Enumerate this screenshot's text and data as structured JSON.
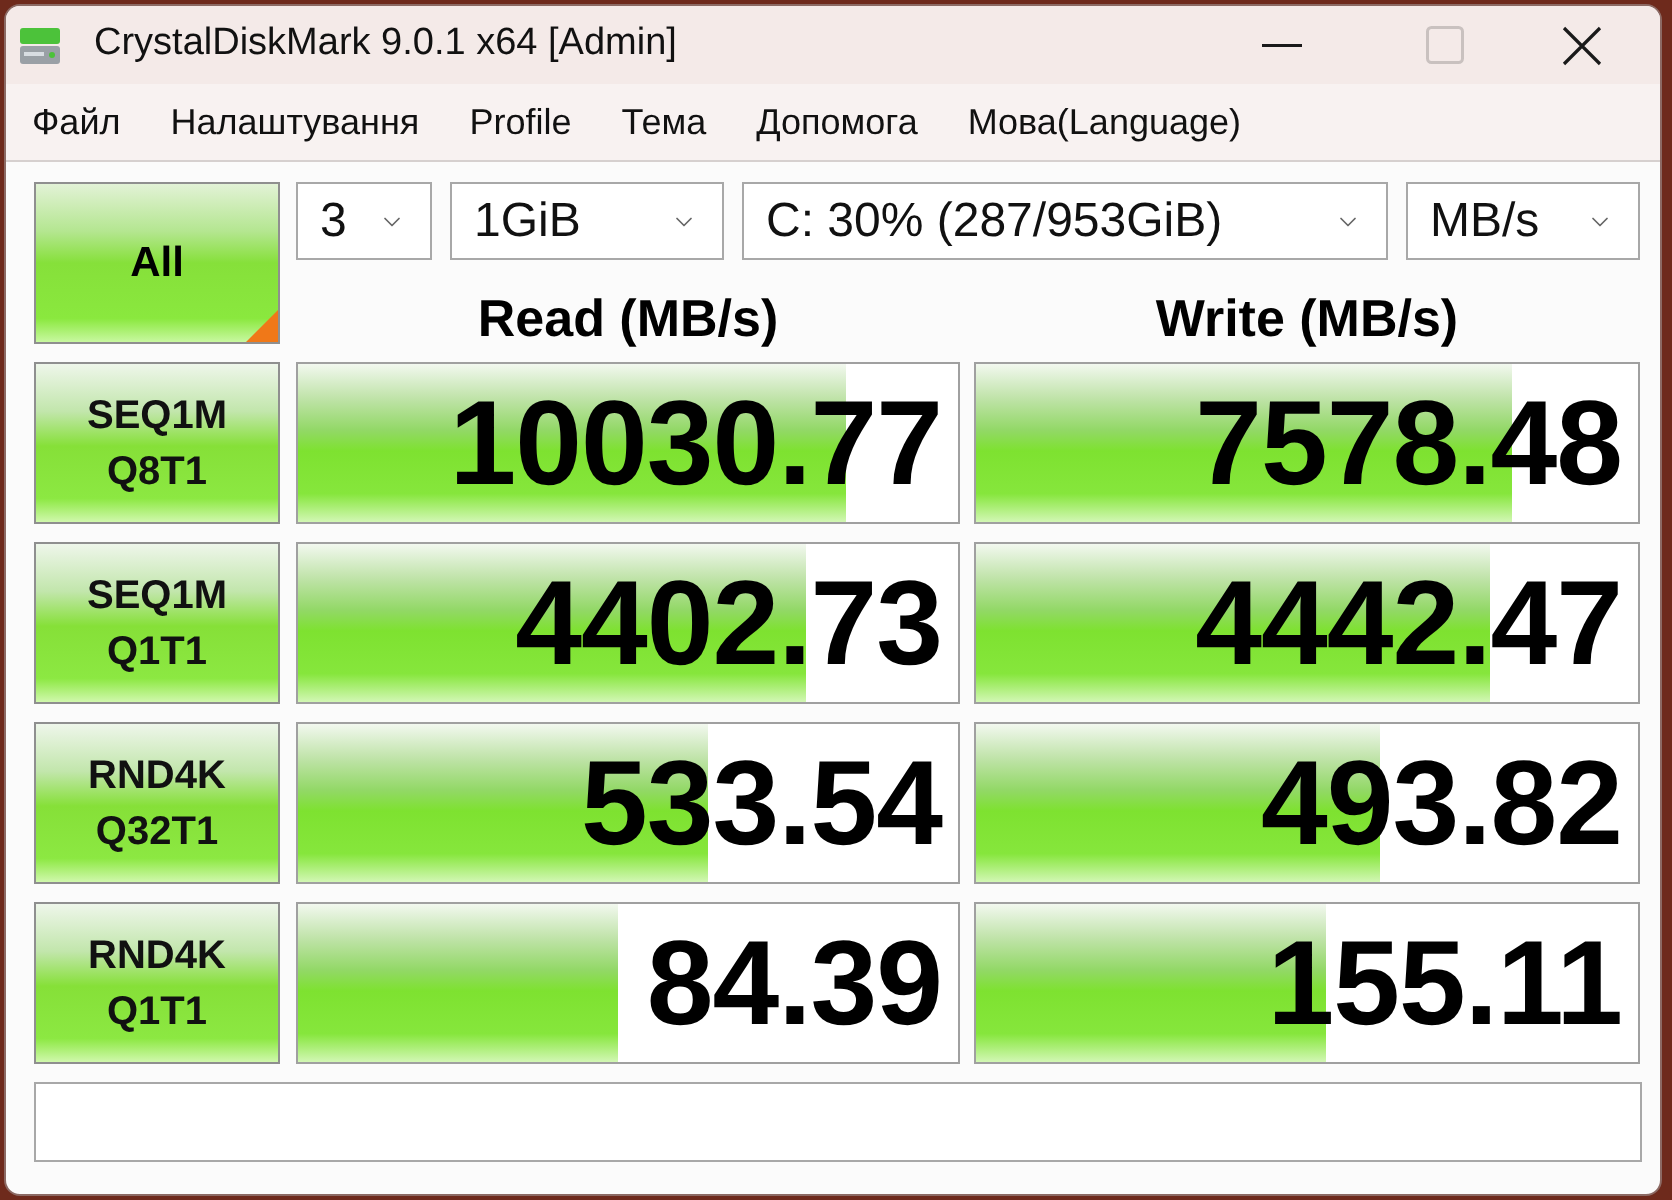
{
  "window": {
    "title": "CrystalDiskMark 9.0.1 x64 [Admin]",
    "maximize_disabled": true
  },
  "menu": [
    "Файл",
    "Налаштування",
    "Profile",
    "Тема",
    "Допомога",
    "Мова(Language)"
  ],
  "toolbar": {
    "all_button": "All",
    "count": "3",
    "size": "1GiB",
    "drive": "C: 30% (287/953GiB)",
    "unit": "MB/s"
  },
  "columns": [
    "Read (MB/s)",
    "Write (MB/s)"
  ],
  "rows": [
    {
      "test": "SEQ1M",
      "params": "Q8T1",
      "read": {
        "value": "10030.77",
        "level": 0.83
      },
      "write": {
        "value": "7578.48",
        "level": 0.81
      }
    },
    {
      "test": "SEQ1M",
      "params": "Q1T1",
      "read": {
        "value": "4402.73",
        "level": 0.77
      },
      "write": {
        "value": "4442.47",
        "level": 0.775
      }
    },
    {
      "test": "RND4K",
      "params": "Q32T1",
      "read": {
        "value": "533.54",
        "level": 0.62
      },
      "write": {
        "value": "493.82",
        "level": 0.61
      }
    },
    {
      "test": "RND4K",
      "params": "Q1T1",
      "read": {
        "value": "84.39",
        "level": 0.485
      },
      "write": {
        "value": "155.11",
        "level": 0.53
      }
    }
  ]
}
